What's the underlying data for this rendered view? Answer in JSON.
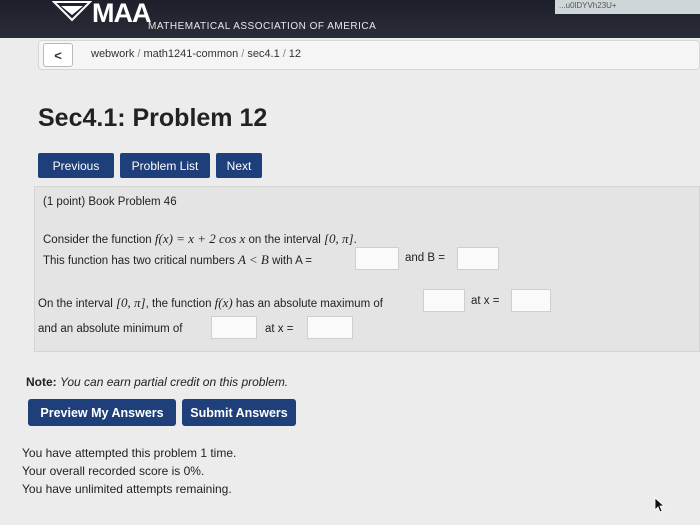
{
  "header": {
    "logo_text": "MAA",
    "org_name": "MATHEMATICAL ASSOCIATION OF AMERICA",
    "url_fragment": "...u0lDYVh23U+"
  },
  "breadcrumb": {
    "back_label": "<",
    "items": [
      "webwork",
      "math1241-common",
      "sec4.1",
      "12"
    ]
  },
  "page_title": "Sec4.1: Problem 12",
  "nav": {
    "previous": "Previous",
    "problem_list": "Problem List",
    "next": "Next"
  },
  "problem": {
    "heading": "(1 point) Book Problem 46",
    "line1_prefix": "Consider the function ",
    "line1_math": "f(x) = x + 2 cos x",
    "line1_mid": " on the interval ",
    "line1_interval": "[0, π]",
    "line1_end": ".",
    "line2_prefix": "This function has two critical numbers ",
    "line2_math": "A < B",
    "line2_withA": " with A =",
    "line2_andB": "and B =",
    "line3_prefix": "On the interval ",
    "line3_interval": "[0, π]",
    "line3_mid": ", the function ",
    "line3_fx": "f(x)",
    "line3_max": " has an absolute maximum of",
    "line3_atx": "at x =",
    "line4_min": "and an absolute minimum of",
    "line4_atx": "at x =",
    "answers": {
      "A": "",
      "B": "",
      "max_value": "",
      "max_x": "",
      "min_value": "",
      "min_x": ""
    }
  },
  "note": {
    "label": "Note:",
    "text": "You can earn partial credit on this problem."
  },
  "actions": {
    "preview": "Preview My Answers",
    "submit": "Submit Answers"
  },
  "status": {
    "attempted": "You have attempted this problem 1 time.",
    "score": "Your overall recorded score is 0%.",
    "remaining": "You have unlimited attempts remaining."
  }
}
